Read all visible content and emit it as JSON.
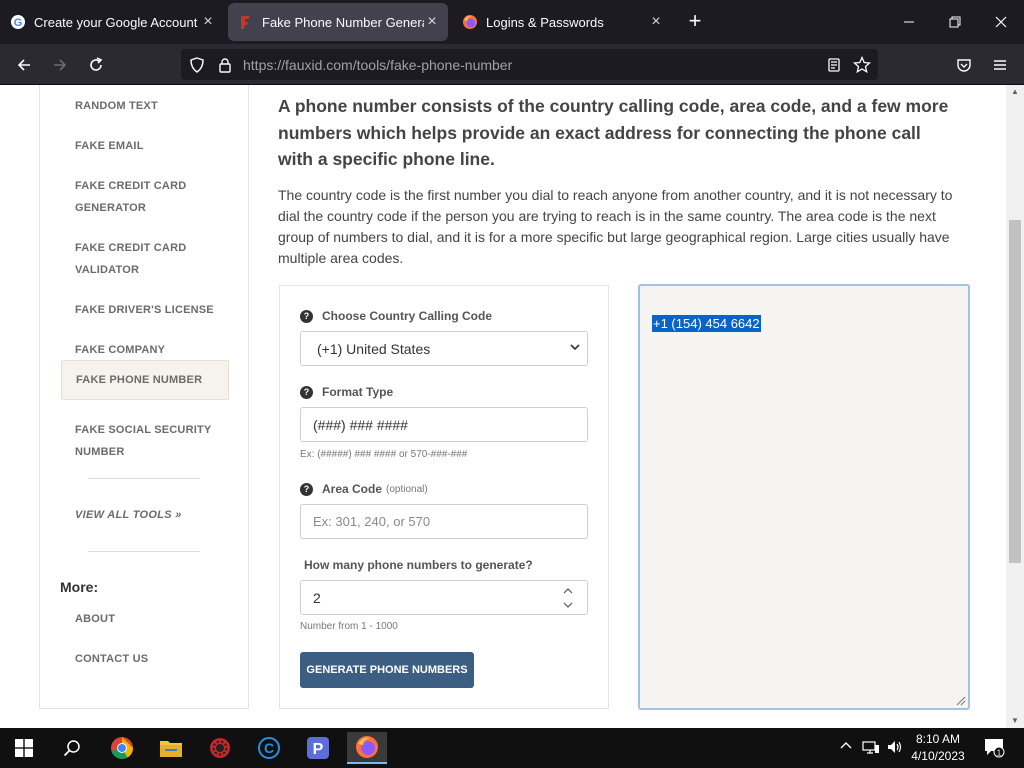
{
  "browser": {
    "tabs": [
      {
        "title": "Create your Google Account",
        "icon": "google-icon"
      },
      {
        "title": "Fake Phone Number Generator",
        "icon": "fauxid-icon"
      },
      {
        "title": "Logins & Passwords",
        "icon": "firefox-icon"
      }
    ],
    "url_host": "https://fauxid.com",
    "url_path": "/tools/fake-phone-number"
  },
  "sidebar": {
    "items": [
      {
        "label": "RANDOM TEXT"
      },
      {
        "label": "FAKE EMAIL"
      },
      {
        "label": "FAKE CREDIT CARD",
        "label2": "GENERATOR"
      },
      {
        "label": "FAKE CREDIT CARD",
        "label2": "VALIDATOR"
      },
      {
        "label": "FAKE DRIVER'S LICENSE"
      },
      {
        "label": "FAKE COMPANY"
      },
      {
        "label": "FAKE PHONE NUMBER"
      },
      {
        "label": "FAKE SOCIAL SECURITY",
        "label2": "NUMBER"
      }
    ],
    "view_all": "VIEW ALL TOOLS »",
    "more_heading": "More:",
    "more_items": [
      {
        "label": "ABOUT"
      },
      {
        "label": "CONTACT US"
      }
    ]
  },
  "main": {
    "headline": "A phone number consists of the country calling code, area code, and a few more numbers which helps provide an exact address for connecting the phone call with a specific phone line.",
    "description": "The country code is the first number you dial to reach anyone from another country, and it is not necessary to dial the country code if the person you are trying to reach is in the same country. The area code is the next group of numbers to dial, and it is for a more specific but large geographical region. Large cities usually have multiple area codes."
  },
  "form": {
    "country_label": "Choose Country Calling Code",
    "country_value": "(+1) United States",
    "format_label": "Format Type",
    "format_value": "(###) ### ####",
    "format_hint": "Ex: (#####) ### #### or 570-###-###",
    "area_label": "Area Code",
    "area_optional": "(optional)",
    "area_placeholder": "Ex: 301, 240, or 570",
    "count_label": "How many phone numbers to generate?",
    "count_value": "2",
    "count_hint": "Number from 1 - 1000",
    "generate_button": "GENERATE PHONE NUMBERS"
  },
  "output": {
    "result": "+1 (154) 454 6642"
  },
  "taskbar": {
    "time": "8:10 AM",
    "date": "4/10/2023",
    "notification_count": "1"
  },
  "colors": {
    "accent_button": "#3d5e83",
    "selection": "#0a64c8",
    "tab_bar": "#1c1b22"
  }
}
